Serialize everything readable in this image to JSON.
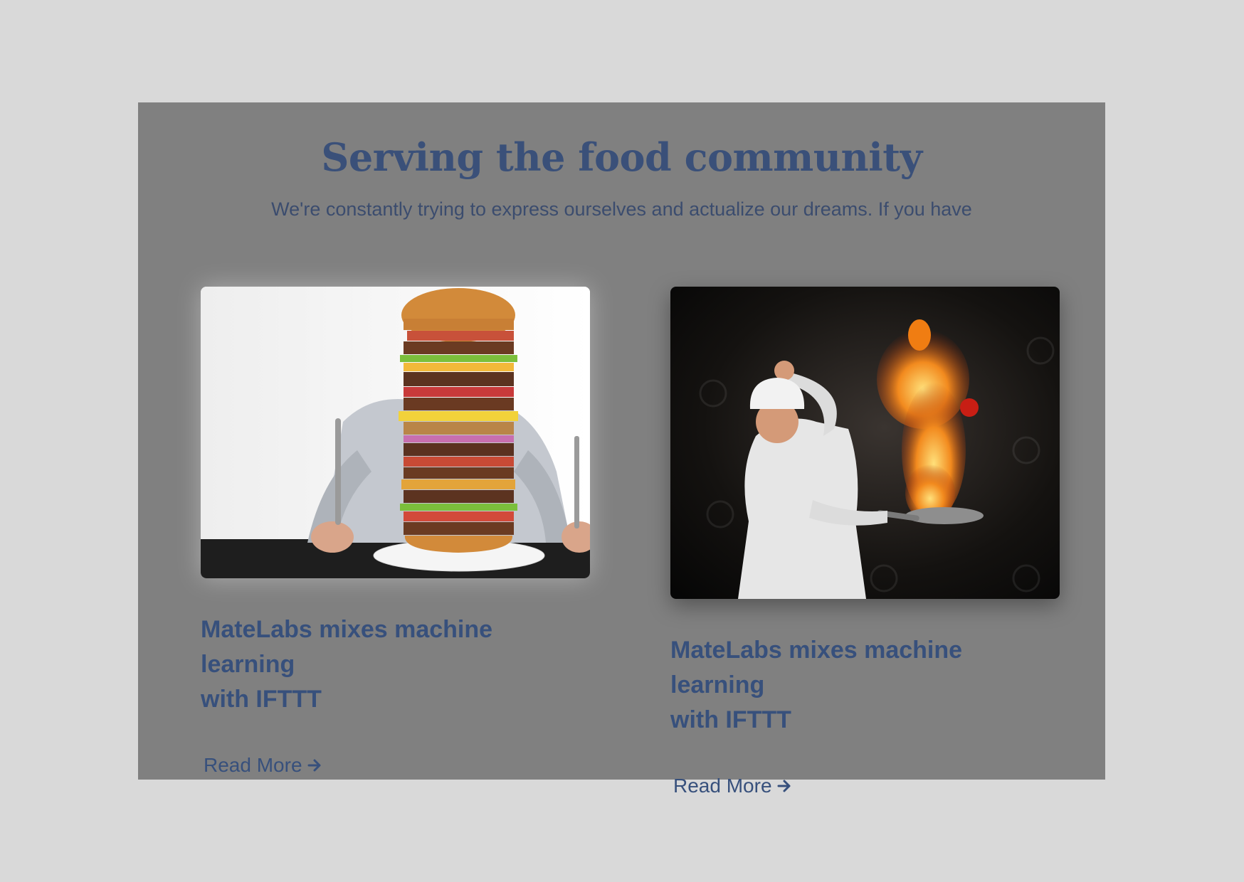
{
  "section": {
    "title": "Serving the food community",
    "subtitle": "We're constantly trying to express ourselves and actualize our dreams. If you have"
  },
  "cards": [
    {
      "title_line1": "MateLabs mixes machine learning",
      "title_line2": "with IFTTT",
      "link_label": "Read More",
      "link_icon": "arrow-right-icon",
      "image": "burger-stack-photo"
    },
    {
      "title_line1": "MateLabs mixes machine learning",
      "title_line2": "with IFTTT",
      "link_label": "Read More",
      "link_icon": "arrow-right-icon",
      "image": "chef-flaming-pan-photo"
    }
  ],
  "colors": {
    "page_bg": "#d9d9d9",
    "panel_bg": "#808080",
    "accent": "#37507c"
  }
}
